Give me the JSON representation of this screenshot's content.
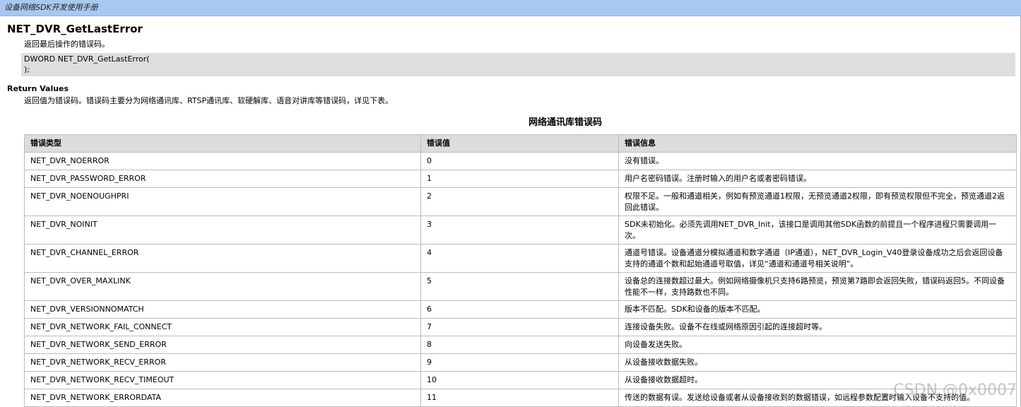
{
  "header": {
    "title": "设备网络SDK开发使用手册"
  },
  "function": {
    "name": "NET_DVR_GetLastError",
    "description": "返回最后操作的错误码。",
    "code_line1": "DWORD NET_DVR_GetLastError(",
    "code_line2": ");"
  },
  "return_values": {
    "heading": "Return Values",
    "description": "返回值为错误码。错误码主要分为网络通讯库、RTSP通讯库、软硬解库、语音对讲库等错误码，详见下表。"
  },
  "table": {
    "title": "网络通讯库错误码",
    "headers": [
      "错误类型",
      "错误值",
      "错误信息"
    ],
    "rows": [
      [
        "NET_DVR_NOERROR",
        "0",
        "没有错误。"
      ],
      [
        "NET_DVR_PASSWORD_ERROR",
        "1",
        "用户名密码错误。注册时输入的用户名或者密码错误。"
      ],
      [
        "NET_DVR_NOENOUGHPRI",
        "2",
        "权限不足。一般和通道相关，例如有预览通道1权限，无预览通道2权限，即有预览权限但不完全，预览通道2返回此错误。"
      ],
      [
        "NET_DVR_NOINIT",
        "3",
        "SDK未初始化。必须先调用NET_DVR_Init，该接口是调用其他SDK函数的前提且一个程序进程只需要调用一次。"
      ],
      [
        "NET_DVR_CHANNEL_ERROR",
        "4",
        "通道号错误。设备通道分模拟通道和数字通道（IP通道），NET_DVR_Login_V40登录设备成功之后会返回设备支持的通道个数和起始通道号取值，详见“通道和通道号相关说明”。"
      ],
      [
        "NET_DVR_OVER_MAXLINK",
        "5",
        "设备总的连接数超过最大。例如网络摄像机只支持6路预览，预览第7路即会返回失败，错误码返回5。不同设备性能不一样，支持路数也不同。"
      ],
      [
        "NET_DVR_VERSIONNOMATCH",
        "6",
        "版本不匹配。SDK和设备的版本不匹配。"
      ],
      [
        "NET_DVR_NETWORK_FAIL_CONNECT",
        "7",
        "连接设备失败。设备不在线或网络原因引起的连接超时等。"
      ],
      [
        "NET_DVR_NETWORK_SEND_ERROR",
        "8",
        "向设备发送失败。"
      ],
      [
        "NET_DVR_NETWORK_RECV_ERROR",
        "9",
        "从设备接收数据失败。"
      ],
      [
        "NET_DVR_NETWORK_RECV_TIMEOUT",
        "10",
        "从设备接收数据超时。"
      ],
      [
        "NET_DVR_NETWORK_ERRORDATA",
        "11",
        "传送的数据有误。发送给设备或者从设备接收到的数据错误，如远程参数配置时输入设备不支持的值。"
      ]
    ]
  },
  "watermark": "CSDN @0x0007"
}
